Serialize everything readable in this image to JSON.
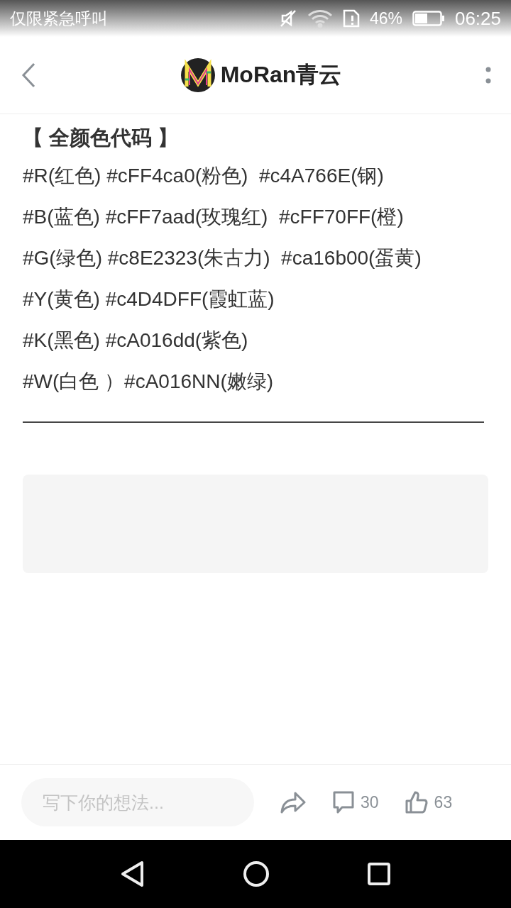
{
  "status_bar": {
    "notice": "仅限紧急呼叫",
    "battery": "46%",
    "time": "06:25"
  },
  "header": {
    "title": "MoRan青云"
  },
  "post": {
    "heading": "【 全颜色代码 】",
    "lines": [
      "#R(红色) #cFF4ca0(粉色)  #c4A766E(钢)",
      "#B(蓝色) #cFF7aad(玫瑰红)  #cFF70FF(橙)",
      "#G(绿色) #c8E2323(朱古力)  #ca16b00(蛋黄)",
      "#Y(黄色) #c4D4DFF(霞虹蓝)",
      "#K(黑色) #cA016dd(紫色)",
      "#W(白色 ）#cA016NN(嫩绿)"
    ],
    "rule": "——————————————————————————"
  },
  "bottom_bar": {
    "comment_field": {
      "placeholder": "写下你的想法..."
    },
    "comments": "30",
    "likes": "63"
  }
}
